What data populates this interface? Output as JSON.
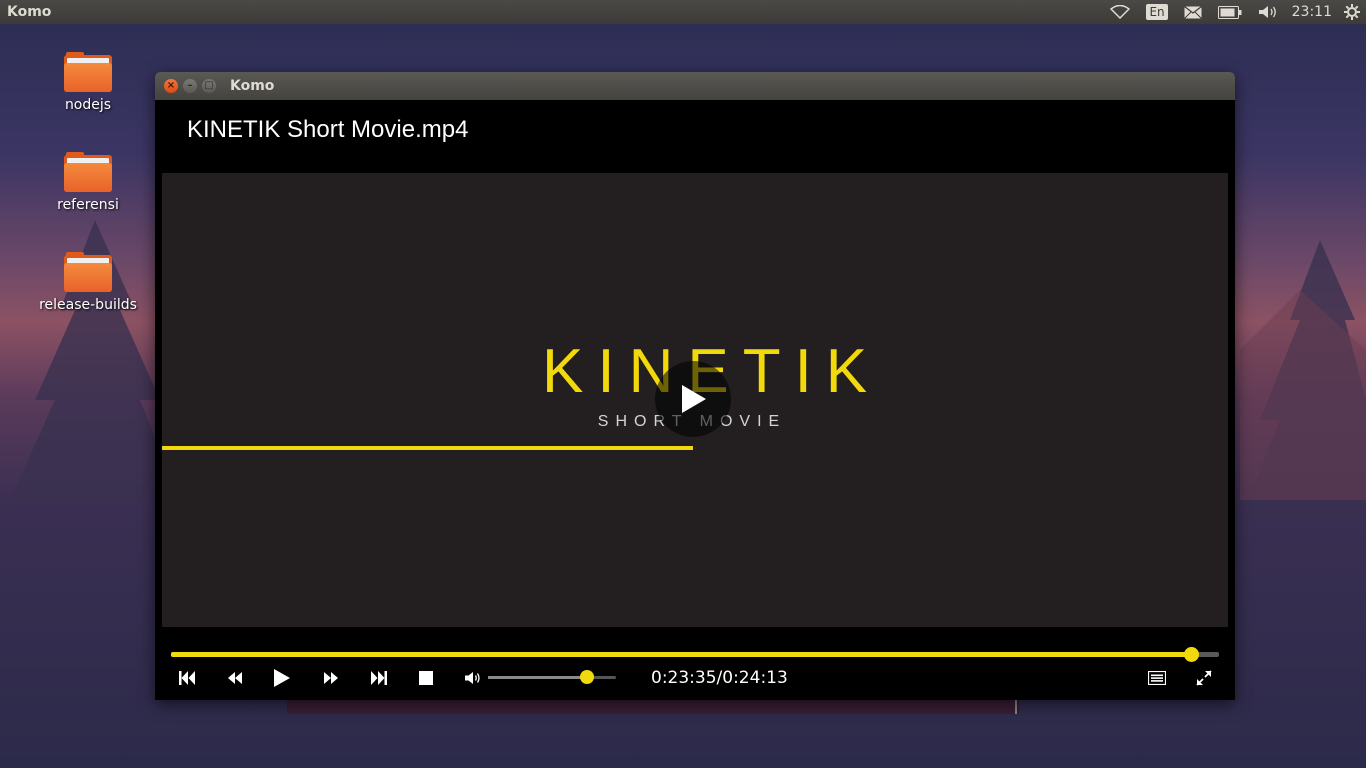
{
  "top_panel": {
    "app_title": "Komo",
    "language": "En",
    "clock": "23:11",
    "icons": [
      "wifi-icon",
      "mail-icon",
      "battery-icon",
      "volume-icon",
      "gear-icon"
    ]
  },
  "desktop": {
    "icons": [
      {
        "label": "nodejs",
        "icon": "folder-icon"
      },
      {
        "label": "referensi",
        "icon": "folder-icon"
      },
      {
        "label": "release-builds",
        "icon": "folder-icon"
      }
    ]
  },
  "window": {
    "title": "Komo",
    "file_title": "KINETIK Short Movie.mp4"
  },
  "video": {
    "logo_text": "KINETIK",
    "subtitle": "SHORT MOVIE",
    "accent_color": "#f2d90c"
  },
  "controls": {
    "time_display": "0:23:35/0:24:13",
    "seek_progress": 0.973,
    "volume_level": 0.77,
    "buttons": [
      "skip-previous-icon",
      "rewind-icon",
      "play-icon",
      "fast-forward-icon",
      "skip-next-icon",
      "stop-icon",
      "volume-icon",
      "playlist-icon",
      "fullscreen-icon"
    ]
  }
}
